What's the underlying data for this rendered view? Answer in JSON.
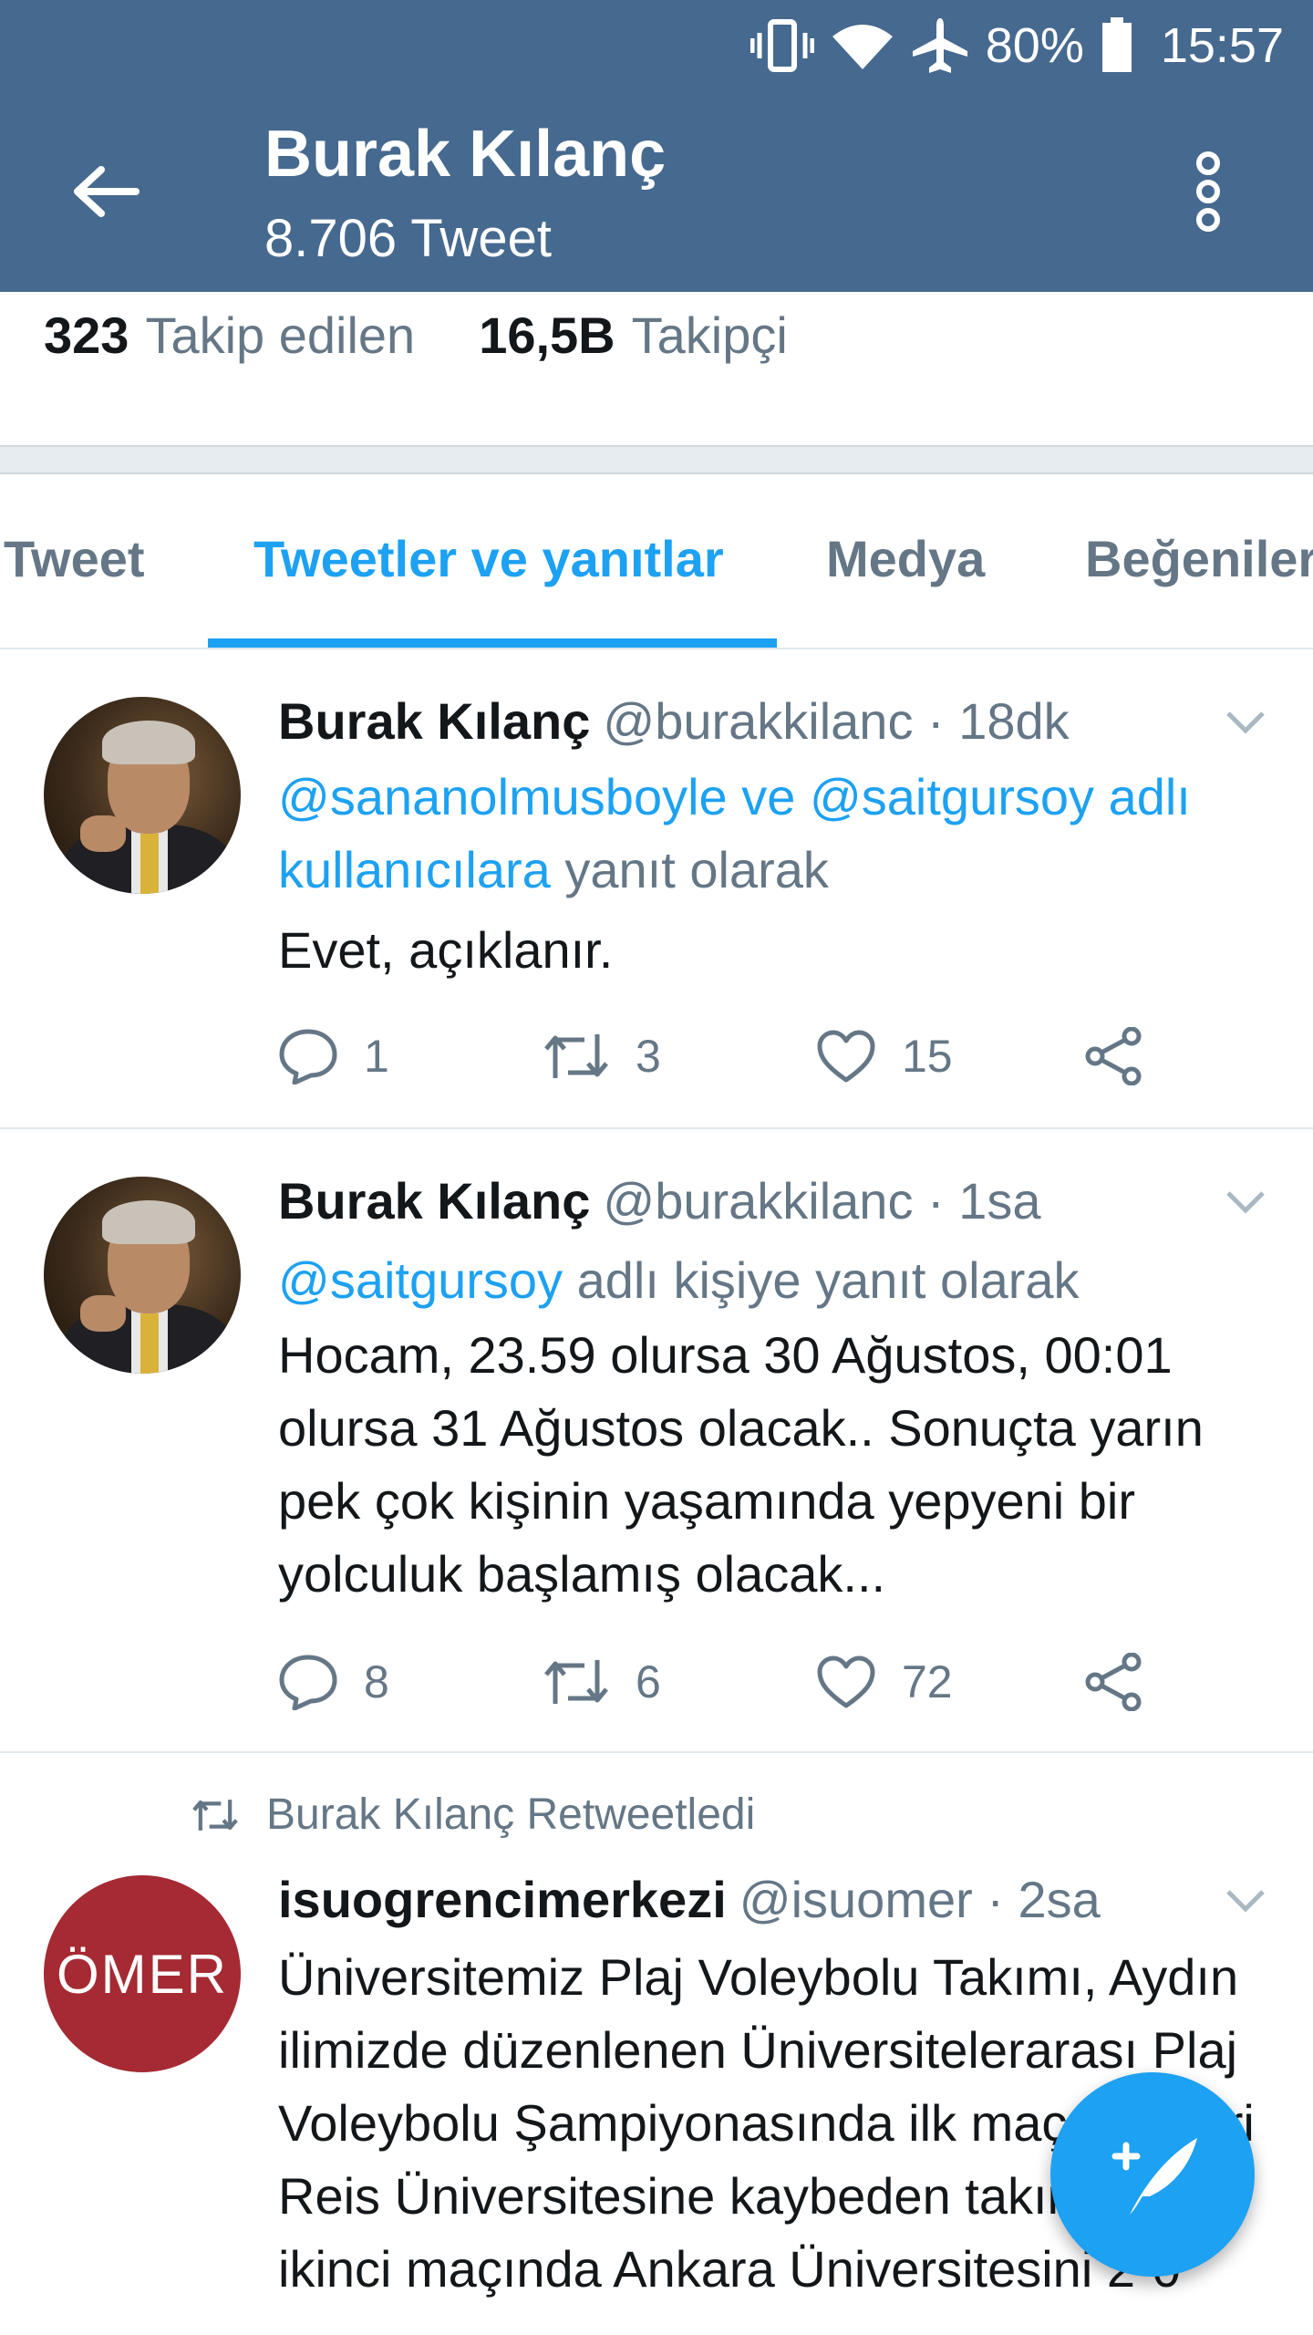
{
  "status_bar": {
    "battery": "80%",
    "time": "15:57",
    "icons": [
      "vibrate-icon",
      "wifi-icon",
      "airplane-icon",
      "battery-icon"
    ]
  },
  "header": {
    "title": "Burak Kılanç",
    "subtitle": "8.706 Tweet"
  },
  "stats": {
    "following_count": "323",
    "following_label": "Takip edilen",
    "followers_count": "16,5B",
    "followers_label": "Takipçi"
  },
  "tabs": [
    {
      "label": "Tweet",
      "active": false
    },
    {
      "label": "Tweetler ve yanıtlar",
      "active": true
    },
    {
      "label": "Medya",
      "active": false
    },
    {
      "label": "Beğeniler",
      "active": false
    }
  ],
  "tweets": [
    {
      "name": "Burak Kılanç",
      "meta": "@burakkilanc · 18dk",
      "reply_links": "@sananolmusboyle ve @saitgursoy adlı kullanıcılara",
      "reply_rest": " yanıt olarak",
      "text": "Evet, açıklanır.",
      "replies": "1",
      "retweets": "3",
      "likes": "15"
    },
    {
      "name": "Burak Kılanç",
      "meta": "@burakkilanc · 1sa",
      "reply_links": "@saitgursoy",
      "reply_rest": " adlı kişiye yanıt olarak",
      "text": "Hocam, 23.59 olursa 30 Ağustos, 00:01 olursa 31 Ağustos olacak.. Sonuçta yarın pek çok kişinin yaşamında yepyeni bir yolculuk başlamış olacak...",
      "replies": "8",
      "retweets": "6",
      "likes": "72"
    },
    {
      "retweeted_by": "Burak Kılanç Retweetledi",
      "name": "isuogrencimerkezi",
      "meta": "@isuomer · 2sa",
      "avatar_logo": "ÖMER",
      "text": "Üniversitemiz Plaj Voleybolu Takımı, Aydın ilimizde düzenlenen Üniversitelerarası Plaj Voleybolu Şampiyonasında ilk maçında Piri Reis Üniversitesine kaybeden takımımız ikinci maçında Ankara Üniversitesini 2-0"
    }
  ],
  "colors": {
    "header_bg": "#46698f",
    "accent": "#1da1f2",
    "muted": "#657786"
  }
}
